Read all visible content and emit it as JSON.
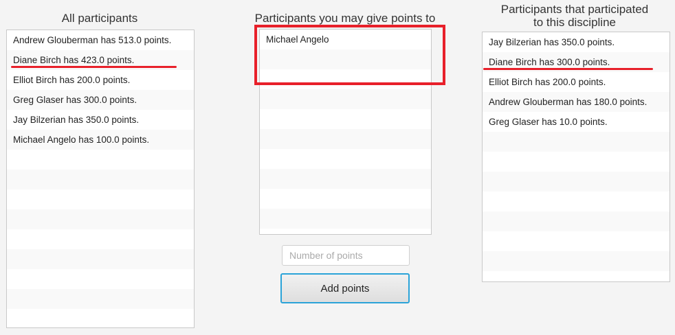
{
  "all": {
    "title": "All participants",
    "items": [
      "Andrew Glouberman has 513.0 points.",
      "Diane Birch has 423.0 points.",
      "Elliot Birch has 200.0 points.",
      "Greg Glaser has 300.0 points.",
      "Jay Bilzerian has 350.0 points.",
      "Michael Angelo has 100.0 points."
    ]
  },
  "give": {
    "title": "Participants you may give points to",
    "items": [
      "Michael Angelo"
    ],
    "points_placeholder": "Number of points",
    "add_label": "Add points"
  },
  "disc": {
    "title_line1": "Participants that participated",
    "title_line2": "to this discipline",
    "items": [
      "Jay Bilzerian has 350.0 points.",
      "Diane Birch has 300.0 points.",
      "Elliot Birch has 200.0 points.",
      "Andrew Glouberman has 180.0 points.",
      "Greg Glaser has 10.0 points."
    ]
  },
  "annotation_color": "#e8202a"
}
